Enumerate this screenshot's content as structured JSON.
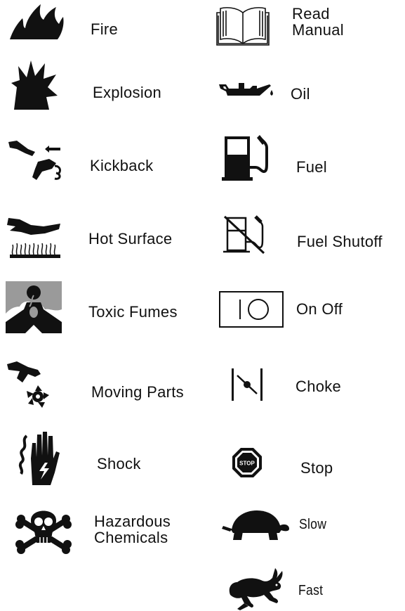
{
  "symbols": {
    "fire": "Fire",
    "explosion": "Explosion",
    "kickback": "Kickback",
    "hot_surface": "Hot Surface",
    "toxic_fumes": "Toxic Fumes",
    "moving_parts": "Moving Parts",
    "shock": "Shock",
    "hazardous_chemicals": [
      "Hazardous",
      "Chemicals"
    ],
    "read_manual": [
      "Read",
      "Manual"
    ],
    "oil": "Oil",
    "fuel": "Fuel",
    "fuel_shutoff": "Fuel Shutoff",
    "on_off": "On Off",
    "choke": "Choke",
    "stop": "Stop",
    "stop_sign_text": "STOP",
    "slow": "Slow",
    "fast": "Fast"
  },
  "icons": [
    "fire-icon",
    "explosion-icon",
    "kickback-icon",
    "hot-surface-icon",
    "toxic-fumes-icon",
    "moving-parts-icon",
    "shock-icon",
    "skull-crossbones-icon",
    "book-icon",
    "oil-can-icon",
    "fuel-pump-icon",
    "fuel-shutoff-icon",
    "on-off-icon",
    "choke-icon",
    "stop-sign-icon",
    "turtle-icon",
    "rabbit-icon"
  ],
  "colors": {
    "ink": "#111111",
    "fume_gray": "#9a9a9a"
  }
}
